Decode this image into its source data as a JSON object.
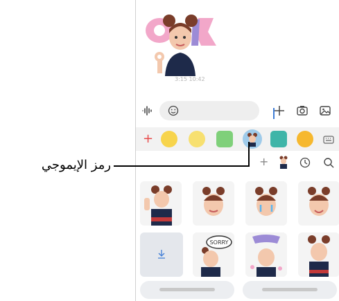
{
  "chat": {
    "message_time": "3:15 10:42"
  },
  "composer": {
    "voice_icon": "waveform-icon",
    "emoji_icon": "smiley-icon",
    "add_icon": "plus-icon",
    "camera_icon": "camera-icon",
    "gallery_icon": "image-icon"
  },
  "tray": {
    "add_label": "+",
    "items": [
      "emoji-1",
      "emoji-2",
      "sticker-green",
      "ar-emoji",
      "sticker-teal",
      "emoji-yellow",
      "keyboard"
    ]
  },
  "subrow": {
    "add_label": "+"
  },
  "callout": {
    "label": "رمز الإيموجي"
  },
  "bottom": {
    "button1": "",
    "button2": ""
  },
  "colors": {
    "accent": "#3f7dd6",
    "selected": "#9fcbea",
    "callout_line": "#000000"
  }
}
